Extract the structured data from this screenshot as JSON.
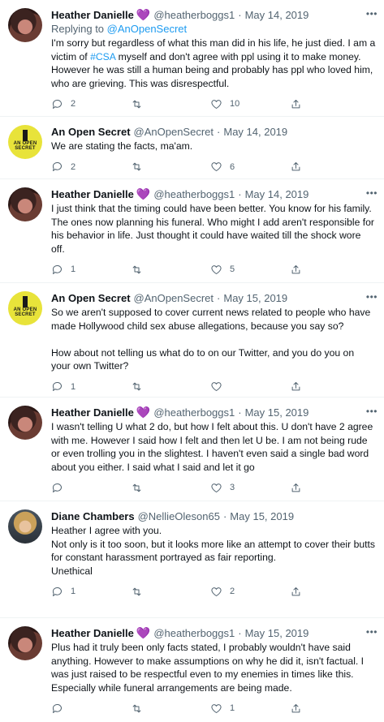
{
  "tweets": [
    {
      "name": "Heather Danielle",
      "heart": "💜",
      "handle": "@heatherboggs1",
      "date": "May 14, 2019",
      "reply_prefix": "Replying to ",
      "reply_to": "@AnOpenSecret",
      "body_pre": "I'm sorry but regardless of what this man did in his life, he just died. I am a victim of ",
      "body_tag": "#CSA",
      "body_post": " myself and don't agree with ppl using it to make money. However he was still a human being and probably has ppl who loved him, who are grieving. This was disrespectful.",
      "replies": "2",
      "retweets": "",
      "likes": "10"
    },
    {
      "name": "An Open Secret",
      "handle": "@AnOpenSecret",
      "date": "May 14, 2019",
      "body": "We are stating the facts, ma'am.",
      "replies": "2",
      "retweets": "",
      "likes": "6"
    },
    {
      "name": "Heather Danielle",
      "heart": "💜",
      "handle": "@heatherboggs1",
      "date": "May 14, 2019",
      "body": "I just think that the timing could have been better. You know for his family. The ones now planning his funeral. Who might I add aren't responsible for his behavior in life. Just thought it could have waited till the shock wore off.",
      "replies": "1",
      "retweets": "",
      "likes": "5"
    },
    {
      "name": "An Open Secret",
      "handle": "@AnOpenSecret",
      "date": "May 15, 2019",
      "body": "So we aren't supposed to cover current news related to people who have made Hollywood child sex abuse allegations, because you say so?\n\nHow about not telling us what do to on our Twitter, and you do you on your own Twitter?",
      "replies": "1",
      "retweets": "",
      "likes": ""
    },
    {
      "name": "Heather Danielle",
      "heart": "💜",
      "handle": "@heatherboggs1",
      "date": "May 15, 2019",
      "body": "I wasn't telling U what 2 do, but how I felt about this. U don't have 2 agree with me. However I said how I felt and then let U be. I am not being rude or even trolling you in the slightest. I haven't even said a single bad word about you either. I said what I said and let it go",
      "replies": "",
      "retweets": "",
      "likes": "3"
    },
    {
      "name": "Diane Chambers",
      "handle": "@NellieOleson65",
      "date": "May 15, 2019",
      "body": "Heather I agree with you.\nNot only is it too soon, but it looks more like an attempt to cover their butts\nfor constant harassment portrayed as fair reporting.\nUnethical",
      "replies": "1",
      "retweets": "",
      "likes": "2"
    },
    {
      "name": "Heather Danielle",
      "heart": "💜",
      "handle": "@heatherboggs1",
      "date": "May 15, 2019",
      "body": "Plus had it truly been only facts stated, I probably wouldn't have said anything. However to make assumptions on why he did it, isn't factual. I was just raised to be respectful even to my enemies in times like this. Especially while funeral arrangements are being made.",
      "replies": "",
      "retweets": "",
      "likes": "1"
    }
  ],
  "ui": {
    "dot": "·",
    "more": "•••",
    "avatar_secret_text_1": "AN OPEN",
    "avatar_secret_text_2": "SECRET"
  },
  "colors": {
    "accent": "#1d9bf0",
    "muted": "#536471",
    "heart": "#a780d6",
    "avatar_secret_bg": "#e8e33a"
  },
  "icons": [
    "reply-icon",
    "retweet-icon",
    "like-icon",
    "share-icon",
    "more-icon"
  ]
}
